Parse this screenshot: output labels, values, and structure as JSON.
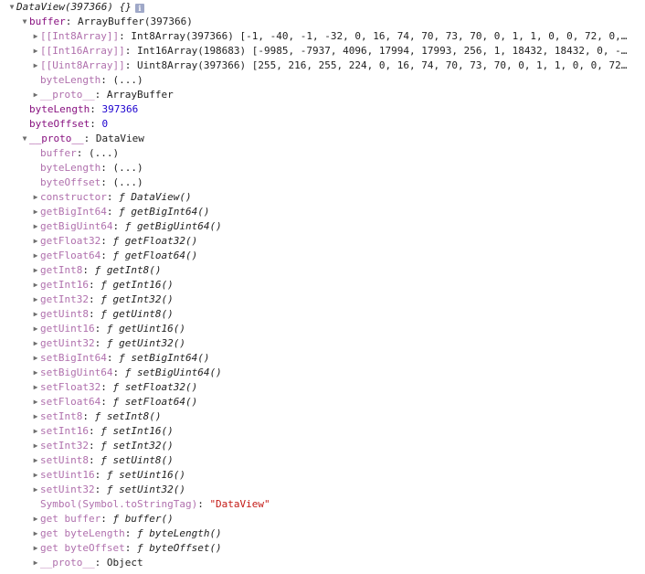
{
  "title": "DataView(397366) {}",
  "rows": [
    {
      "indent": 0,
      "arrow": "down",
      "type": "header",
      "text": "DataView(397366) {}",
      "info": true
    },
    {
      "indent": 1,
      "arrow": "down",
      "key": "buffer",
      "val": "ArrayBuffer(397366)",
      "vclass": "plain"
    },
    {
      "indent": 2,
      "arrow": "right",
      "key": "[[Int8Array]]",
      "keyclass": "dim",
      "val": "Int8Array(397366) [-1, -40, -1, -32, 0, 16, 74, 70, 73, 70, 0, 1, 1, 0, 0, 72, 0,…",
      "vclass": "plain"
    },
    {
      "indent": 2,
      "arrow": "right",
      "key": "[[Int16Array]]",
      "keyclass": "dim",
      "val": "Int16Array(198683) [-9985, -7937, 4096, 17994, 17993, 256, 1, 18432, 18432, 0, -…",
      "vclass": "plain"
    },
    {
      "indent": 2,
      "arrow": "right",
      "key": "[[Uint8Array]]",
      "keyclass": "dim",
      "val": "Uint8Array(397366) [255, 216, 255, 224, 0, 16, 74, 70, 73, 70, 0, 1, 1, 0, 0, 72…",
      "vclass": "plain"
    },
    {
      "indent": 2,
      "arrow": "none",
      "key": "byteLength",
      "keyclass": "dim",
      "val": "(...)",
      "vclass": "plain"
    },
    {
      "indent": 2,
      "arrow": "right",
      "key": "__proto__",
      "keyclass": "dim",
      "val": "ArrayBuffer",
      "vclass": "plain"
    },
    {
      "indent": 1,
      "arrow": "none",
      "key": "byteLength",
      "val": "397366",
      "vclass": "num"
    },
    {
      "indent": 1,
      "arrow": "none",
      "key": "byteOffset",
      "val": "0",
      "vclass": "num"
    },
    {
      "indent": 1,
      "arrow": "down",
      "key": "__proto__",
      "val": "DataView",
      "vclass": "plain"
    },
    {
      "indent": 2,
      "arrow": "none",
      "key": "buffer",
      "keyclass": "dim",
      "val": "(...)",
      "vclass": "plain"
    },
    {
      "indent": 2,
      "arrow": "none",
      "key": "byteLength",
      "keyclass": "dim",
      "val": "(...)",
      "vclass": "plain"
    },
    {
      "indent": 2,
      "arrow": "none",
      "key": "byteOffset",
      "keyclass": "dim",
      "val": "(...)",
      "vclass": "plain"
    },
    {
      "indent": 2,
      "arrow": "right",
      "key": "constructor",
      "keyclass": "dim",
      "val": "ƒ DataView()",
      "vclass": "fn"
    },
    {
      "indent": 2,
      "arrow": "right",
      "key": "getBigInt64",
      "keyclass": "dim",
      "val": "ƒ getBigInt64()",
      "vclass": "fn"
    },
    {
      "indent": 2,
      "arrow": "right",
      "key": "getBigUint64",
      "keyclass": "dim",
      "val": "ƒ getBigUint64()",
      "vclass": "fn"
    },
    {
      "indent": 2,
      "arrow": "right",
      "key": "getFloat32",
      "keyclass": "dim",
      "val": "ƒ getFloat32()",
      "vclass": "fn"
    },
    {
      "indent": 2,
      "arrow": "right",
      "key": "getFloat64",
      "keyclass": "dim",
      "val": "ƒ getFloat64()",
      "vclass": "fn"
    },
    {
      "indent": 2,
      "arrow": "right",
      "key": "getInt8",
      "keyclass": "dim",
      "val": "ƒ getInt8()",
      "vclass": "fn"
    },
    {
      "indent": 2,
      "arrow": "right",
      "key": "getInt16",
      "keyclass": "dim",
      "val": "ƒ getInt16()",
      "vclass": "fn"
    },
    {
      "indent": 2,
      "arrow": "right",
      "key": "getInt32",
      "keyclass": "dim",
      "val": "ƒ getInt32()",
      "vclass": "fn"
    },
    {
      "indent": 2,
      "arrow": "right",
      "key": "getUint8",
      "keyclass": "dim",
      "val": "ƒ getUint8()",
      "vclass": "fn"
    },
    {
      "indent": 2,
      "arrow": "right",
      "key": "getUint16",
      "keyclass": "dim",
      "val": "ƒ getUint16()",
      "vclass": "fn"
    },
    {
      "indent": 2,
      "arrow": "right",
      "key": "getUint32",
      "keyclass": "dim",
      "val": "ƒ getUint32()",
      "vclass": "fn"
    },
    {
      "indent": 2,
      "arrow": "right",
      "key": "setBigInt64",
      "keyclass": "dim",
      "val": "ƒ setBigInt64()",
      "vclass": "fn"
    },
    {
      "indent": 2,
      "arrow": "right",
      "key": "setBigUint64",
      "keyclass": "dim",
      "val": "ƒ setBigUint64()",
      "vclass": "fn"
    },
    {
      "indent": 2,
      "arrow": "right",
      "key": "setFloat32",
      "keyclass": "dim",
      "val": "ƒ setFloat32()",
      "vclass": "fn"
    },
    {
      "indent": 2,
      "arrow": "right",
      "key": "setFloat64",
      "keyclass": "dim",
      "val": "ƒ setFloat64()",
      "vclass": "fn"
    },
    {
      "indent": 2,
      "arrow": "right",
      "key": "setInt8",
      "keyclass": "dim",
      "val": "ƒ setInt8()",
      "vclass": "fn"
    },
    {
      "indent": 2,
      "arrow": "right",
      "key": "setInt16",
      "keyclass": "dim",
      "val": "ƒ setInt16()",
      "vclass": "fn"
    },
    {
      "indent": 2,
      "arrow": "right",
      "key": "setInt32",
      "keyclass": "dim",
      "val": "ƒ setInt32()",
      "vclass": "fn"
    },
    {
      "indent": 2,
      "arrow": "right",
      "key": "setUint8",
      "keyclass": "dim",
      "val": "ƒ setUint8()",
      "vclass": "fn"
    },
    {
      "indent": 2,
      "arrow": "right",
      "key": "setUint16",
      "keyclass": "dim",
      "val": "ƒ setUint16()",
      "vclass": "fn"
    },
    {
      "indent": 2,
      "arrow": "right",
      "key": "setUint32",
      "keyclass": "dim",
      "val": "ƒ setUint32()",
      "vclass": "fn"
    },
    {
      "indent": 2,
      "arrow": "none",
      "key": "Symbol(Symbol.toStringTag)",
      "keyclass": "dim",
      "val": "\"DataView\"",
      "vclass": "str"
    },
    {
      "indent": 2,
      "arrow": "right",
      "key": "get buffer",
      "keyclass": "dim",
      "val": "ƒ buffer()",
      "vclass": "fn"
    },
    {
      "indent": 2,
      "arrow": "right",
      "key": "get byteLength",
      "keyclass": "dim",
      "val": "ƒ byteLength()",
      "vclass": "fn"
    },
    {
      "indent": 2,
      "arrow": "right",
      "key": "get byteOffset",
      "keyclass": "dim",
      "val": "ƒ byteOffset()",
      "vclass": "fn"
    },
    {
      "indent": 2,
      "arrow": "right",
      "key": "__proto__",
      "keyclass": "dim",
      "val": "Object",
      "vclass": "plain"
    }
  ],
  "colors": {
    "key": "#881280",
    "key_dim": "#b070ad",
    "number": "#1c00cf",
    "string": "#c41a16",
    "arrow": "#6e6e6e",
    "info_icon_bg": "#9fa8c8"
  },
  "icons": {
    "expanded": "triangle-down-icon",
    "collapsed": "triangle-right-icon",
    "info": "info-icon"
  }
}
